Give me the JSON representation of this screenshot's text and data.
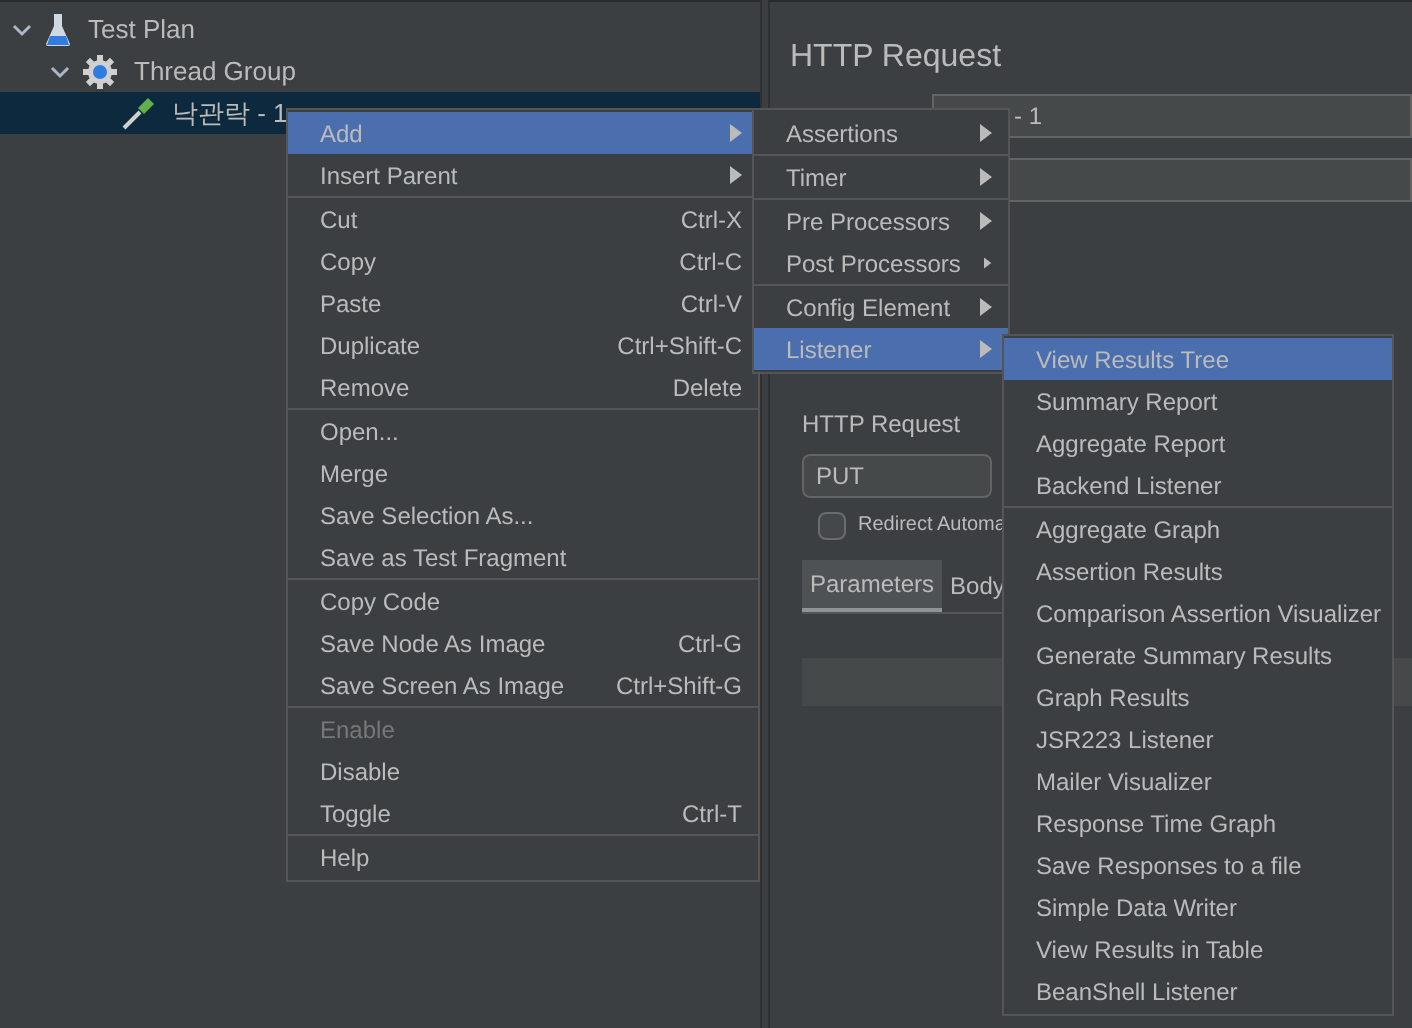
{
  "tree": [
    {
      "label": "Test Plan",
      "kind": "plan",
      "expanded": true,
      "selected": false,
      "children": [
        {
          "label": "Thread Group",
          "kind": "group",
          "expanded": true,
          "selected": false,
          "children": [
            {
              "label": "낙관락 - 1",
              "kind": "sampler",
              "selected": true
            }
          ]
        }
      ]
    }
  ],
  "editor": {
    "title": "HTTP Request",
    "name_value": "- 1",
    "group_label": "HTTP Request",
    "method": "PUT",
    "redirect": {
      "label": "Redirect Automa",
      "checked": false
    },
    "tabs": [
      {
        "label": "Parameters",
        "selected": true
      },
      {
        "label": "Body",
        "selected": false
      }
    ]
  },
  "context_menu": {
    "sections": [
      [
        {
          "label": "Add",
          "submenu": true,
          "selected": true,
          "disabled": false
        },
        {
          "label": "Insert Parent",
          "submenu": true,
          "selected": false,
          "disabled": false
        }
      ],
      [
        {
          "label": "Cut",
          "shortcut": "Ctrl-X",
          "submenu": false,
          "selected": false,
          "disabled": false
        },
        {
          "label": "Copy",
          "shortcut": "Ctrl-C",
          "submenu": false,
          "selected": false,
          "disabled": false
        },
        {
          "label": "Paste",
          "shortcut": "Ctrl-V",
          "submenu": false,
          "selected": false,
          "disabled": false
        },
        {
          "label": "Duplicate",
          "shortcut": "Ctrl+Shift-C",
          "submenu": false,
          "selected": false,
          "disabled": false
        },
        {
          "label": "Remove",
          "shortcut": "Delete",
          "submenu": false,
          "selected": false,
          "disabled": false
        }
      ],
      [
        {
          "label": "Open...",
          "submenu": false,
          "selected": false,
          "disabled": false
        },
        {
          "label": "Merge",
          "submenu": false,
          "selected": false,
          "disabled": false
        },
        {
          "label": "Save Selection As...",
          "submenu": false,
          "selected": false,
          "disabled": false
        },
        {
          "label": "Save as Test Fragment",
          "submenu": false,
          "selected": false,
          "disabled": false
        }
      ],
      [
        {
          "label": "Copy Code",
          "submenu": false,
          "selected": false,
          "disabled": false
        },
        {
          "label": "Save Node As Image",
          "shortcut": "Ctrl-G",
          "submenu": false,
          "selected": false,
          "disabled": false
        },
        {
          "label": "Save Screen As Image",
          "shortcut": "Ctrl+Shift-G",
          "submenu": false,
          "selected": false,
          "disabled": false
        }
      ],
      [
        {
          "label": "Enable",
          "submenu": false,
          "selected": false,
          "disabled": true
        },
        {
          "label": "Disable",
          "submenu": false,
          "selected": false,
          "disabled": false
        },
        {
          "label": "Toggle",
          "shortcut": "Ctrl-T",
          "submenu": false,
          "selected": false,
          "disabled": false
        }
      ],
      [
        {
          "label": "Help",
          "submenu": false,
          "selected": false,
          "disabled": false
        }
      ]
    ]
  },
  "add_menu": {
    "sections": [
      [
        {
          "label": "Assertions",
          "submenu": true,
          "selected": false,
          "disabled": false
        }
      ],
      [
        {
          "label": "Timer",
          "submenu": true,
          "selected": false,
          "disabled": false
        }
      ],
      [
        {
          "label": "Pre Processors",
          "submenu": true,
          "selected": false,
          "disabled": false
        },
        {
          "label": "Post Processors",
          "submenu": true,
          "selected": false,
          "disabled": false
        }
      ],
      [
        {
          "label": "Config Element",
          "submenu": true,
          "selected": false,
          "disabled": false
        },
        {
          "label": "Listener",
          "submenu": true,
          "selected": true,
          "disabled": false
        }
      ]
    ]
  },
  "listener_menu": {
    "sections": [
      [
        {
          "label": "View Results Tree",
          "submenu": false,
          "selected": true,
          "disabled": false
        },
        {
          "label": "Summary Report",
          "submenu": false,
          "selected": false,
          "disabled": false
        },
        {
          "label": "Aggregate Report",
          "submenu": false,
          "selected": false,
          "disabled": false
        },
        {
          "label": "Backend Listener",
          "submenu": false,
          "selected": false,
          "disabled": false
        }
      ],
      [
        {
          "label": "Aggregate Graph",
          "submenu": false,
          "selected": false,
          "disabled": false
        },
        {
          "label": "Assertion Results",
          "submenu": false,
          "selected": false,
          "disabled": false
        },
        {
          "label": "Comparison Assertion Visualizer",
          "submenu": false,
          "selected": false,
          "disabled": false
        },
        {
          "label": "Generate Summary Results",
          "submenu": false,
          "selected": false,
          "disabled": false
        },
        {
          "label": "Graph Results",
          "submenu": false,
          "selected": false,
          "disabled": false
        },
        {
          "label": "JSR223 Listener",
          "submenu": false,
          "selected": false,
          "disabled": false
        },
        {
          "label": "Mailer Visualizer",
          "submenu": false,
          "selected": false,
          "disabled": false
        },
        {
          "label": "Response Time Graph",
          "submenu": false,
          "selected": false,
          "disabled": false
        },
        {
          "label": "Save Responses to a file",
          "submenu": false,
          "selected": false,
          "disabled": false
        },
        {
          "label": "Simple Data Writer",
          "submenu": false,
          "selected": false,
          "disabled": false
        },
        {
          "label": "View Results in Table",
          "submenu": false,
          "selected": false,
          "disabled": false
        },
        {
          "label": "BeanShell Listener",
          "submenu": false,
          "selected": false,
          "disabled": false
        }
      ]
    ]
  }
}
